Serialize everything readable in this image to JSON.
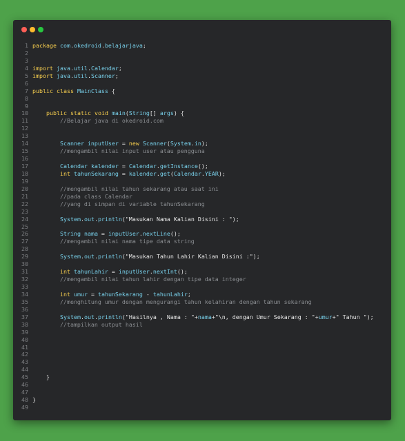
{
  "window": {
    "controls": {
      "close_color": "#ff5f57",
      "minimize_color": "#febc2e",
      "maximize_color": "#28c840"
    }
  },
  "code": {
    "lines": [
      "package com.okedroid.belajarjava;",
      "",
      "",
      "import java.util.Calendar;",
      "import java.util.Scanner;",
      "",
      "public class MainClass {",
      "",
      "",
      "    public static void main(String[] args) {",
      "        //Belajar java di okedroid.com",
      "",
      "",
      "        Scanner inputUser = new Scanner(System.in);",
      "        //mengambil nilai input user atau pengguna",
      "",
      "        Calendar kalender = Calendar.getInstance();",
      "        int tahunSekarang = kalender.get(Calendar.YEAR);",
      "",
      "        //mengambil nilai tahun sekarang atau saat ini",
      "        //pada class Calendar",
      "        //yang di simpan di variable tahunSekarang",
      "",
      "        System.out.println(\"Masukan Nama Kalian Disini : \");",
      "",
      "        String nama = inputUser.nextLine();",
      "        //mengambil nilai nama tipe data string",
      "",
      "        System.out.println(\"Masukan Tahun Lahir Kalian Disini :\");",
      "",
      "        int tahunLahir = inputUser.nextInt();",
      "        //mengambil nilai tahun lahir dengan tipe data integer",
      "",
      "        int umur = tahunSekarang - tahunLahir;",
      "        //menghitung umur dengan mengurangi tahun kelahiran dengan tahun sekarang",
      "",
      "        System.out.println(\"Hasilnya , Nama : \"+nama+\"\\n, dengan Umur Sekarang : \"+umur+\" Tahun \");",
      "        //tampilkan output hasil",
      "",
      "",
      "",
      "",
      "",
      "",
      "    }",
      "",
      "",
      "}",
      ""
    ]
  }
}
